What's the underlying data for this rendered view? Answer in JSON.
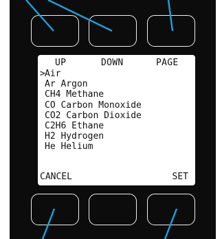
{
  "top_softkeys": [
    {
      "label": "UP"
    },
    {
      "label": "DOWN"
    },
    {
      "label": "PAGE"
    }
  ],
  "gas_list": {
    "selected_index": 0,
    "cursor_glyph": ">",
    "items": [
      "Air",
      "Ar Argon",
      "CH4 Methane",
      "CO Carbon Monoxide",
      "CO2 Carbon Dioxide",
      "C2H6 Ethane",
      "H2 Hydrogen",
      "He Helium"
    ]
  },
  "bottom_softkeys": [
    {
      "label": "CANCEL"
    },
    {
      "label": ""
    },
    {
      "label": "SET"
    }
  ],
  "colors": {
    "device_body": "#0c0c0c",
    "button_outline": "#f2f2f2",
    "screen_bg": "#ffffff",
    "pointer_lines": "#1aa3e0"
  }
}
